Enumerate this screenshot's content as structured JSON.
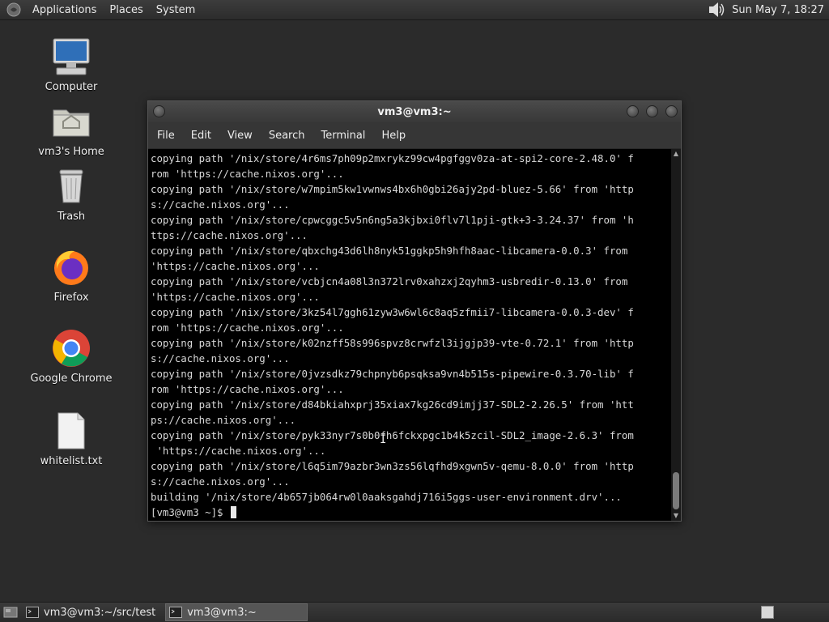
{
  "top_panel": {
    "menus": [
      "Applications",
      "Places",
      "System"
    ],
    "clock": "Sun May  7, 18:27"
  },
  "desktop_icons": [
    {
      "label": "Computer",
      "icon": "computer-icon"
    },
    {
      "label": "vm3's Home",
      "icon": "home-folder-icon"
    },
    {
      "label": "Trash",
      "icon": "trash-icon"
    },
    {
      "label": "Firefox",
      "icon": "firefox-icon"
    },
    {
      "label": "Google Chrome",
      "icon": "chrome-icon"
    },
    {
      "label": "whitelist.txt",
      "icon": "text-file-icon"
    }
  ],
  "terminal": {
    "title": "vm3@vm3:~",
    "menu": [
      "File",
      "Edit",
      "View",
      "Search",
      "Terminal",
      "Help"
    ],
    "output": "copying path '/nix/store/4r6ms7ph09p2mxrykz99cw4pgfggv0za-at-spi2-core-2.48.0' f\nrom 'https://cache.nixos.org'...\ncopying path '/nix/store/w7mpim5kw1vwnws4bx6h0gbi26ajy2pd-bluez-5.66' from 'http\ns://cache.nixos.org'...\ncopying path '/nix/store/cpwcggc5v5n6ng5a3kjbxi0flv7l1pji-gtk+3-3.24.37' from 'h\nttps://cache.nixos.org'...\ncopying path '/nix/store/qbxchg43d6lh8nyk51ggkp5h9hfh8aac-libcamera-0.0.3' from\n'https://cache.nixos.org'...\ncopying path '/nix/store/vcbjcn4a08l3n372lrv0xahzxj2qyhm3-usbredir-0.13.0' from\n'https://cache.nixos.org'...\ncopying path '/nix/store/3kz54l7ggh61zyw3w6wl6c8aq5zfmii7-libcamera-0.0.3-dev' f\nrom 'https://cache.nixos.org'...\ncopying path '/nix/store/k02nzff58s996spvz8crwfzl3ijgjp39-vte-0.72.1' from 'http\ns://cache.nixos.org'...\ncopying path '/nix/store/0jvzsdkz79chpnyb6psqksa9vn4b515s-pipewire-0.3.70-lib' f\nrom 'https://cache.nixos.org'...\ncopying path '/nix/store/d84bkiahxprj35xiax7kg26cd9imjj37-SDL2-2.26.5' from 'htt\nps://cache.nixos.org'...\ncopying path '/nix/store/pyk33nyr7s0b0fh6fckxpgc1b4k5zcil-SDL2_image-2.6.3' from\n 'https://cache.nixos.org'...\ncopying path '/nix/store/l6q5im79azbr3wn3zs56lqfhd9xgwn5v-qemu-8.0.0' from 'http\ns://cache.nixos.org'...\nbuilding '/nix/store/4b657jb064rw0l0aaksgahdj716i5ggs-user-environment.drv'...",
    "prompt": "[vm3@vm3 ~]$ "
  },
  "taskbar": {
    "tasks": [
      {
        "label": "vm3@vm3:~/src/test",
        "active": false
      },
      {
        "label": "vm3@vm3:~",
        "active": true
      }
    ]
  }
}
